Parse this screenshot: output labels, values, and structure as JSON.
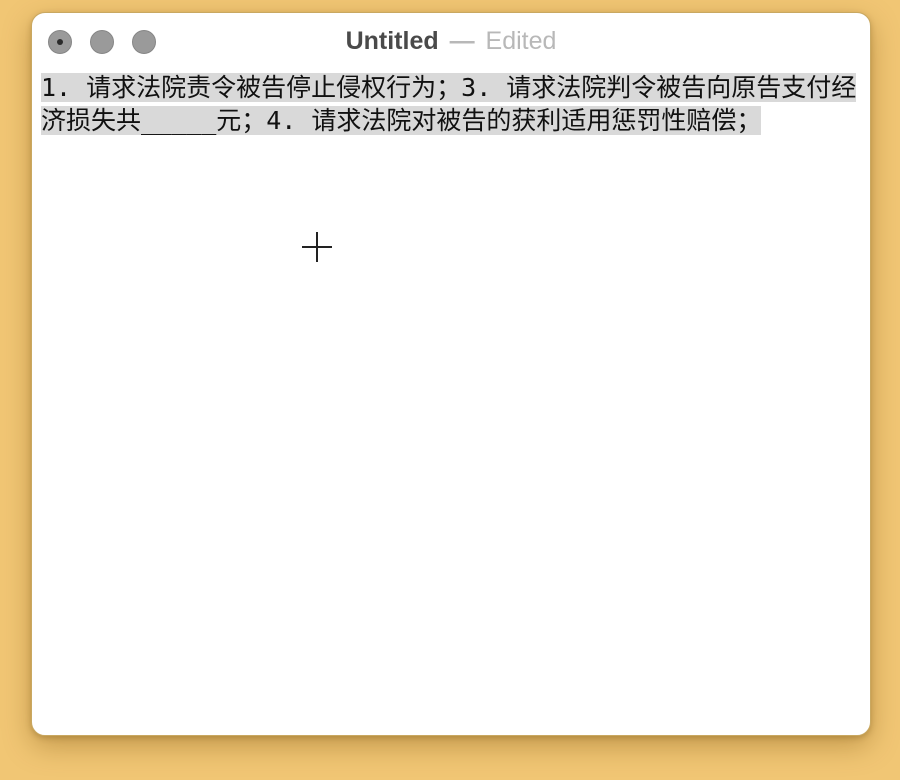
{
  "window": {
    "title": "Untitled",
    "separator": "—",
    "state": "Edited"
  },
  "editor": {
    "text": "1. 请求法院责令被告停止侵权行为；3. 请求法院判令被告向原告支付经济损失共_____元；4. 请求法院对被告的获利适用惩罚性赔偿；",
    "selection": "all text selected"
  },
  "colors": {
    "desktop": "#f1c674",
    "selection": "#d9d9d9"
  },
  "icons": {
    "close": "close-icon",
    "minimize": "minimize-icon",
    "zoom": "zoom-icon",
    "pointer": "crosshair-cursor-icon"
  }
}
